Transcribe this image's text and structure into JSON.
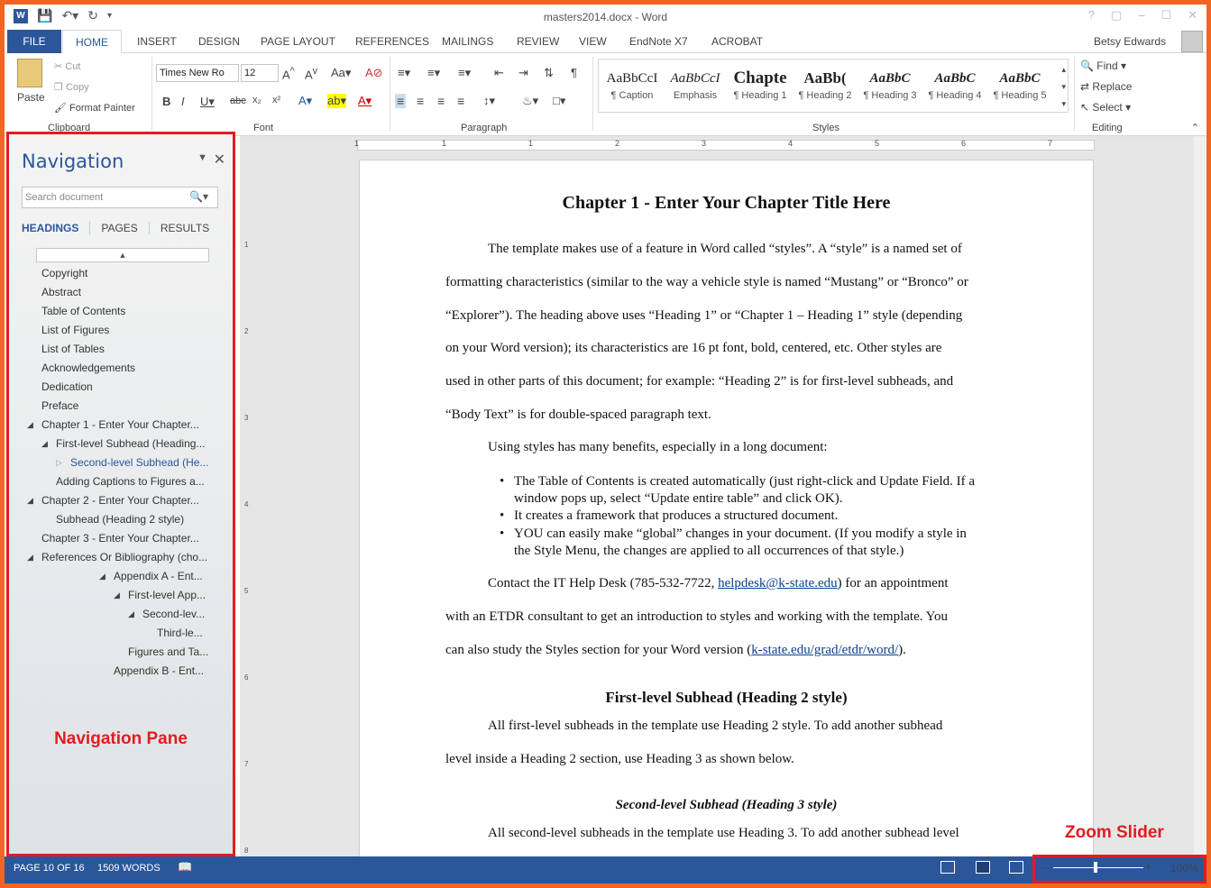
{
  "window": {
    "title": "masters2014.docx - Word",
    "user": "Betsy Edwards",
    "controls": [
      "?",
      "▢",
      "–",
      "☐",
      "✕"
    ]
  },
  "tabs": [
    "FILE",
    "HOME",
    "INSERT",
    "DESIGN",
    "PAGE LAYOUT",
    "REFERENCES",
    "MAILINGS",
    "REVIEW",
    "VIEW",
    "EndNote X7",
    "ACROBAT"
  ],
  "ribbon": {
    "clipboard": {
      "paste": "Paste",
      "cut": "Cut",
      "copy": "Copy",
      "format_painter": "Format Painter",
      "label": "Clipboard"
    },
    "font": {
      "name": "Times New Ro",
      "size": "12",
      "label": "Font"
    },
    "paragraph": {
      "label": "Paragraph"
    },
    "styles": {
      "label": "Styles",
      "items": [
        {
          "sample": "AaBbCcI",
          "name": "¶ Caption"
        },
        {
          "sample": "AaBbCcI",
          "name": "Emphasis"
        },
        {
          "sample": "Chapte",
          "name": "¶ Heading 1"
        },
        {
          "sample": "AaBb(",
          "name": "¶ Heading 2"
        },
        {
          "sample": "AaBbC",
          "name": "¶ Heading 3"
        },
        {
          "sample": "AaBbC",
          "name": "¶ Heading 4"
        },
        {
          "sample": "AaBbC",
          "name": "¶ Heading 5"
        }
      ]
    },
    "editing": {
      "find": "Find",
      "replace": "Replace",
      "select": "Select",
      "label": "Editing"
    }
  },
  "navigation": {
    "title": "Navigation",
    "search_placeholder": "Search document",
    "tabs": [
      "HEADINGS",
      "PAGES",
      "RESULTS"
    ],
    "items": [
      {
        "label": "Copyright"
      },
      {
        "label": "Abstract"
      },
      {
        "label": "Table of Contents"
      },
      {
        "label": "List of Figures"
      },
      {
        "label": "List of Tables"
      },
      {
        "label": "Acknowledgements"
      },
      {
        "label": "Dedication"
      },
      {
        "label": "Preface"
      },
      {
        "label": "Chapter 1 -  Enter Your Chapter..."
      },
      {
        "label": "First-level Subhead (Heading..."
      },
      {
        "label": "Second-level Subhead (He..."
      },
      {
        "label": "Adding Captions to Figures a..."
      },
      {
        "label": "Chapter 2 -  Enter Your Chapter..."
      },
      {
        "label": "Subhead (Heading 2 style)"
      },
      {
        "label": "Chapter 3 -  Enter Your Chapter..."
      },
      {
        "label": "References Or Bibliography (cho..."
      },
      {
        "label": "Appendix A -  Ent..."
      },
      {
        "label": "First-level App..."
      },
      {
        "label": "Second-lev..."
      },
      {
        "label": "Third-le..."
      },
      {
        "label": "Figures and Ta..."
      },
      {
        "label": "Appendix B -  Ent..."
      }
    ],
    "callout": "Navigation Pane"
  },
  "document": {
    "h1": "Chapter 1 - Enter Your Chapter Title Here",
    "p1": [
      "The template makes use of a feature in Word called “styles”.  A “style” is a named set of",
      "formatting characteristics (similar to the way a vehicle style is named “Mustang” or “Bronco” or",
      "“Explorer”).  The heading above uses “Heading 1” or “Chapter 1 – Heading 1” style (depending",
      "on your Word version); its characteristics are 16 pt font, bold, centered, etc.   Other styles are",
      "used in other parts of this document; for example: “Heading 2” is for first-level subheads, and",
      "“Body Text” is for double-spaced paragraph text."
    ],
    "p2": "Using styles has many benefits, especially in a long document:",
    "bullets": [
      [
        "The Table of Contents is created automatically (just right-click and Update Field. If a",
        "window pops up, select “Update entire table” and click OK)."
      ],
      [
        "It creates a framework that produces a structured document."
      ],
      [
        "YOU can easily make “global” changes in your document.  (If you modify a style in",
        "the Style Menu, the changes are applied to all occurrences of that style.)"
      ]
    ],
    "p3_a": "Contact the IT Help Desk (785-532-7722, ",
    "p3_link": "helpdesk@k-state.edu",
    "p3_b": ") for an appointment",
    "p3_line2": "with an ETDR consultant to get an introduction to styles and working with the template.  You",
    "p3_line3_a": "can also study the Styles section for your Word version (",
    "p3_line3_link": "k-state.edu/grad/etdr/word/",
    "p3_line3_b": ").",
    "h2": "First-level Subhead (Heading 2 style)",
    "p4": [
      "All first-level subheads in the template use Heading 2 style.  To add another subhead",
      "level inside a Heading 2 section, use Heading 3 as shown below."
    ],
    "h3": "Second-level Subhead (Heading 3 style)",
    "p5": "All second-level subheads in the template use Heading 3.  To add another subhead level"
  },
  "status": {
    "page": "PAGE 10 OF 16",
    "words": "1509 WORDS",
    "zoom": "100%",
    "zoom_level_percent": 100,
    "zoom_callout": "Zoom Slider"
  },
  "colors": {
    "accent": "#2b579a",
    "annotation": "#e21c21",
    "frame": "#f26522"
  }
}
